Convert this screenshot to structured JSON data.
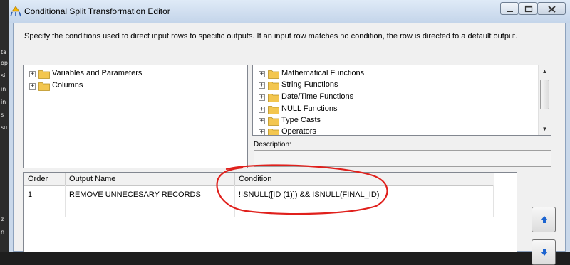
{
  "window": {
    "title": "Conditional Split Transformation Editor",
    "instructions": "Specify the conditions used to direct input rows to specific outputs. If an input row matches no condition, the row is directed to a default output."
  },
  "left_strip": {
    "chars": [
      "ta",
      "op",
      "si",
      "in",
      "in",
      "s",
      "su",
      "z",
      "n"
    ]
  },
  "left_tree": {
    "items": [
      {
        "label": "Variables and Parameters",
        "icon": "folder-icon"
      },
      {
        "label": "Columns",
        "icon": "folder-icon"
      }
    ]
  },
  "functions_tree": {
    "items": [
      {
        "label": "Mathematical Functions",
        "icon": "folder-icon"
      },
      {
        "label": "String Functions",
        "icon": "folder-icon"
      },
      {
        "label": "Date/Time Functions",
        "icon": "folder-icon"
      },
      {
        "label": "NULL Functions",
        "icon": "folder-icon"
      },
      {
        "label": "Type Casts",
        "icon": "folder-icon"
      },
      {
        "label": "Operators",
        "icon": "folder-icon"
      }
    ]
  },
  "description": {
    "label": "Description:",
    "value": ""
  },
  "grid": {
    "headers": [
      "Order",
      "Output Name",
      "Condition"
    ],
    "rows": [
      {
        "order": "1",
        "output_name": "REMOVE UNNECESARY RECORDS",
        "condition": "!ISNULL([ID (1)]) && ISNULL(FINAL_ID)"
      }
    ]
  },
  "colors": {
    "annotation": "#e0201c",
    "folder": "#f3c64f",
    "arrow": "#1c64d0"
  }
}
